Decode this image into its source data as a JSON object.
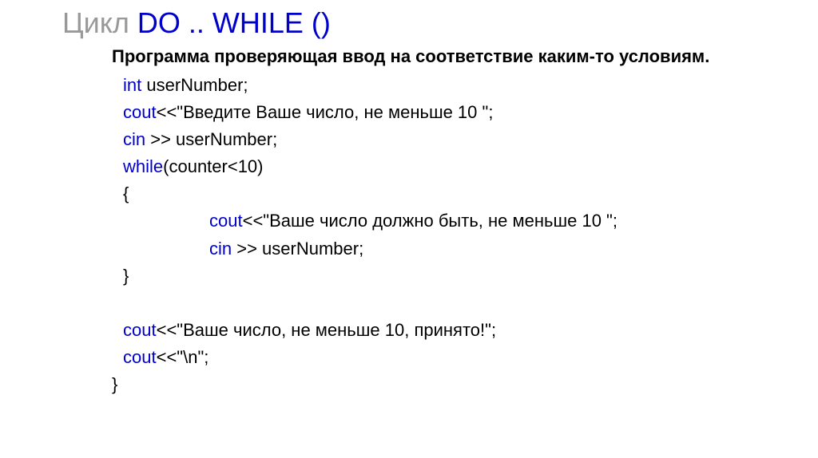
{
  "title": {
    "prefix": "Цикл ",
    "keywords": "DO ..  WHILE ()"
  },
  "subtitle": "Программа проверяющая ввод на соответствие каким-то условиям.",
  "code": {
    "line1": {
      "kw": "int",
      "rest": " userNumber;"
    },
    "line2": {
      "kw": "cout",
      "rest": "<<\"Введите Ваше число, не меньше 10 \";"
    },
    "line3": {
      "kw": "cin",
      "rest": " >> userNumber;"
    },
    "line4": {
      "kw": "while",
      "rest": "(counter<10)"
    },
    "line5": "{",
    "line6": {
      "kw": "cout",
      "rest": "<<\"Ваше число должно быть, не меньше 10 \";"
    },
    "line7": {
      "kw": "cin",
      "rest": " >> userNumber;"
    },
    "line8": " }",
    "line9": {
      "kw": "cout",
      "rest": "<<\"Ваше число, не меньше 10, принято!\";"
    },
    "line10": {
      "kw": "cout",
      "rest": "<<\"\\n\";"
    },
    "line11": "}"
  }
}
